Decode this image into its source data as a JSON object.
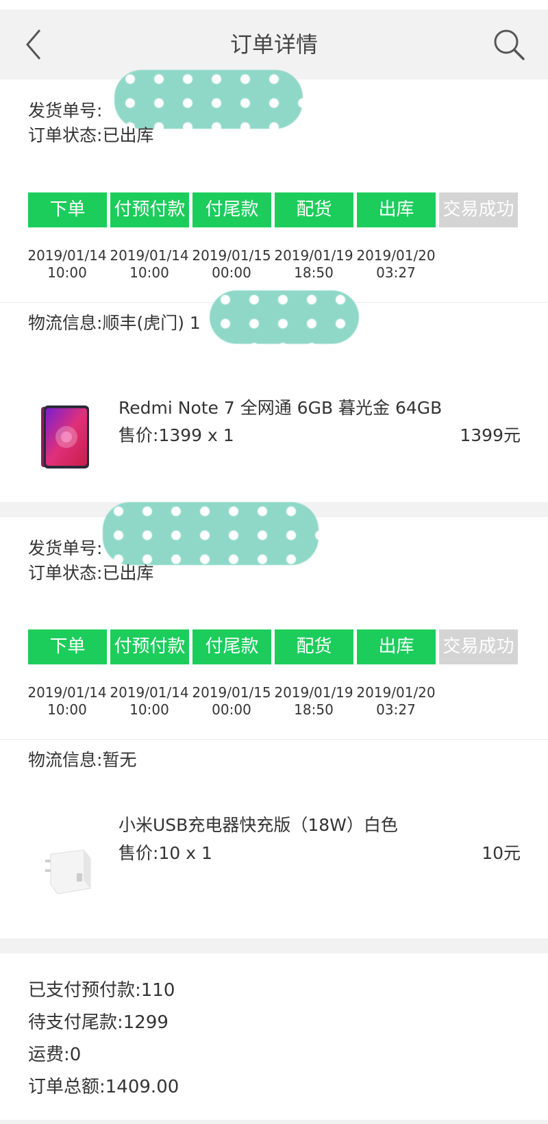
{
  "header": {
    "title": "订单详情",
    "back_icon": "chevron-left-icon",
    "search_icon": "search-icon"
  },
  "colors": {
    "step_active": "#1ccd5c",
    "step_inactive": "#d4d4d4",
    "background_gray": "#f2f2f2",
    "redaction": "#8fd8c8"
  },
  "orders": [
    {
      "shipment_label": "发货单号:",
      "shipment_no_visible": "",
      "status_label": "订单状态:",
      "status_value": "已出库",
      "steps": [
        {
          "label": "下单",
          "date": "2019/01/14",
          "time": "10:00",
          "done": true
        },
        {
          "label": "付预付款",
          "date": "2019/01/14",
          "time": "10:00",
          "done": true
        },
        {
          "label": "付尾款",
          "date": "2019/01/15",
          "time": "00:00",
          "done": true
        },
        {
          "label": "配货",
          "date": "2019/01/19",
          "time": "18:50",
          "done": true
        },
        {
          "label": "出库",
          "date": "2019/01/20",
          "time": "03:27",
          "done": true
        },
        {
          "label": "交易成功",
          "date": "",
          "time": "",
          "done": false
        }
      ],
      "logistics_label": "物流信息:",
      "logistics_value": "顺丰(虎门)  1",
      "product": {
        "name": "Redmi Note 7 全网通 6GB 暮光金 64GB",
        "price_label": "售价:",
        "price_value": "1399 x 1",
        "total": "1399元",
        "image": "phone-image"
      }
    },
    {
      "shipment_label": "发货单号:",
      "shipment_no_visible": "",
      "status_label": "订单状态:",
      "status_value": "已出库",
      "steps": [
        {
          "label": "下单",
          "date": "2019/01/14",
          "time": "10:00",
          "done": true
        },
        {
          "label": "付预付款",
          "date": "2019/01/14",
          "time": "10:00",
          "done": true
        },
        {
          "label": "付尾款",
          "date": "2019/01/15",
          "time": "00:00",
          "done": true
        },
        {
          "label": "配货",
          "date": "2019/01/19",
          "time": "18:50",
          "done": true
        },
        {
          "label": "出库",
          "date": "2019/01/20",
          "time": "03:27",
          "done": true
        },
        {
          "label": "交易成功",
          "date": "",
          "time": "",
          "done": false
        }
      ],
      "logistics_label": "物流信息:",
      "logistics_value": "暂无",
      "product": {
        "name": "小米USB充电器快充版（18W）白色",
        "price_label": "售价:",
        "price_value": "10 x 1",
        "total": "10元",
        "image": "charger-image"
      }
    }
  ],
  "summary": {
    "prepaid_label": "已支付预付款:",
    "prepaid_value": "110",
    "balance_label": "待支付尾款:",
    "balance_value": "1299",
    "shipping_label": "运费:",
    "shipping_value": "0",
    "total_label": "订单总额:",
    "total_value": "1409.00"
  }
}
